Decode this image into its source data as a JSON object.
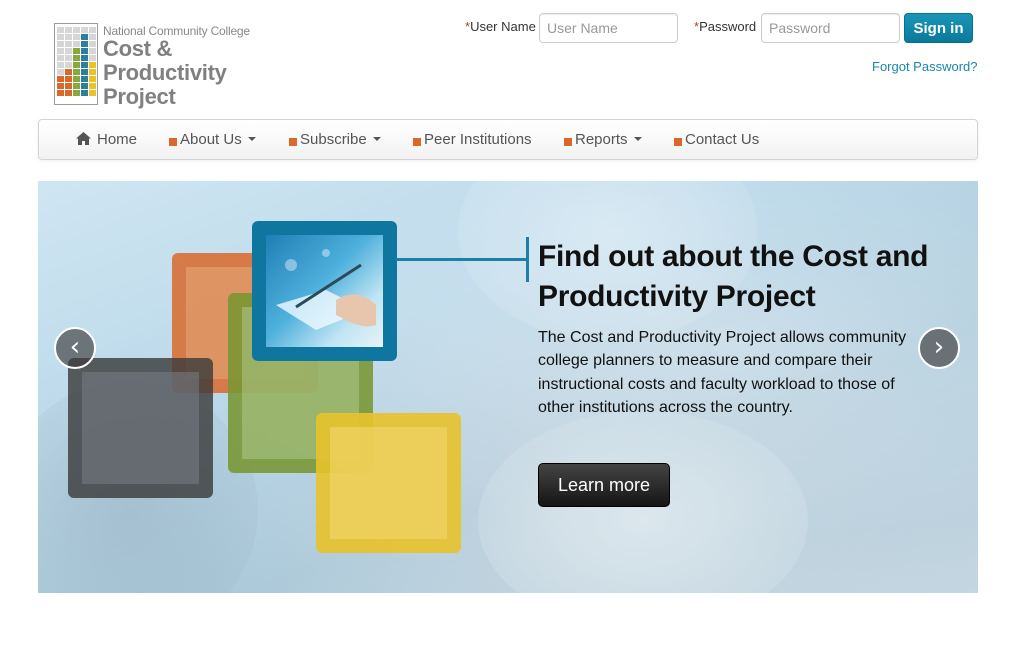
{
  "logo": {
    "org": "National Community College",
    "title_line1": "Cost &",
    "title_line2": "Productivity",
    "title_line3": "Project",
    "grid_colors": [
      "#d6d6d6",
      "#d6d6d6",
      "#d6d6d6",
      "#d6d6d6",
      "#d6d6d6",
      "#d6d6d6",
      "#d6d6d6",
      "#d6d6d6",
      "#2a7f9e",
      "#d6d6d6",
      "#d6d6d6",
      "#d6d6d6",
      "#d6d6d6",
      "#2a7f9e",
      "#d6d6d6",
      "#d6d6d6",
      "#d6d6d6",
      "#8aa73b",
      "#2a7f9e",
      "#d6d6d6",
      "#d6d6d6",
      "#d6d6d6",
      "#8aa73b",
      "#2a7f9e",
      "#d6d6d6",
      "#d6d6d6",
      "#d6d6d6",
      "#8aa73b",
      "#2a7f9e",
      "#e8c22a",
      "#d6d6d6",
      "#d9682b",
      "#8aa73b",
      "#2a7f9e",
      "#e8c22a",
      "#d9682b",
      "#d9682b",
      "#8aa73b",
      "#2a7f9e",
      "#e8c22a",
      "#d9682b",
      "#d9682b",
      "#8aa73b",
      "#2a7f9e",
      "#e8c22a",
      "#d9682b",
      "#d9682b",
      "#8aa73b",
      "#2a7f9e",
      "#e8c22a"
    ]
  },
  "login": {
    "username_label": "User Name",
    "username_placeholder": "User Name",
    "password_label": "Password",
    "password_placeholder": "Password",
    "required_mark": "*",
    "signin_label": "Sign in",
    "forgot_label": "Forgot Password?"
  },
  "nav": {
    "items": [
      {
        "label": "Home",
        "icon": "home-icon",
        "dropdown": false
      },
      {
        "label": "About Us",
        "icon": "square-bullet",
        "dropdown": true
      },
      {
        "label": "Subscribe",
        "icon": "square-bullet",
        "dropdown": true
      },
      {
        "label": "Peer Institutions",
        "icon": "square-bullet",
        "dropdown": false
      },
      {
        "label": "Reports",
        "icon": "square-bullet",
        "dropdown": true
      },
      {
        "label": "Contact Us",
        "icon": "square-bullet",
        "dropdown": false
      }
    ]
  },
  "hero": {
    "headline": "Find out about the Cost and Productivity Project",
    "body": "The Cost and Productivity Project allows community college planners to measure and compare their instructional costs and faculty workload to those of other institutions across the country.",
    "button_label": "Learn more",
    "prev_glyph": "‹",
    "next_glyph": "›"
  },
  "colors": {
    "accent": "#1b7fa8",
    "orange": "#d9682b",
    "green": "#8aa73b",
    "yellow": "#e8c22a",
    "dark": "#4a4a4a"
  }
}
